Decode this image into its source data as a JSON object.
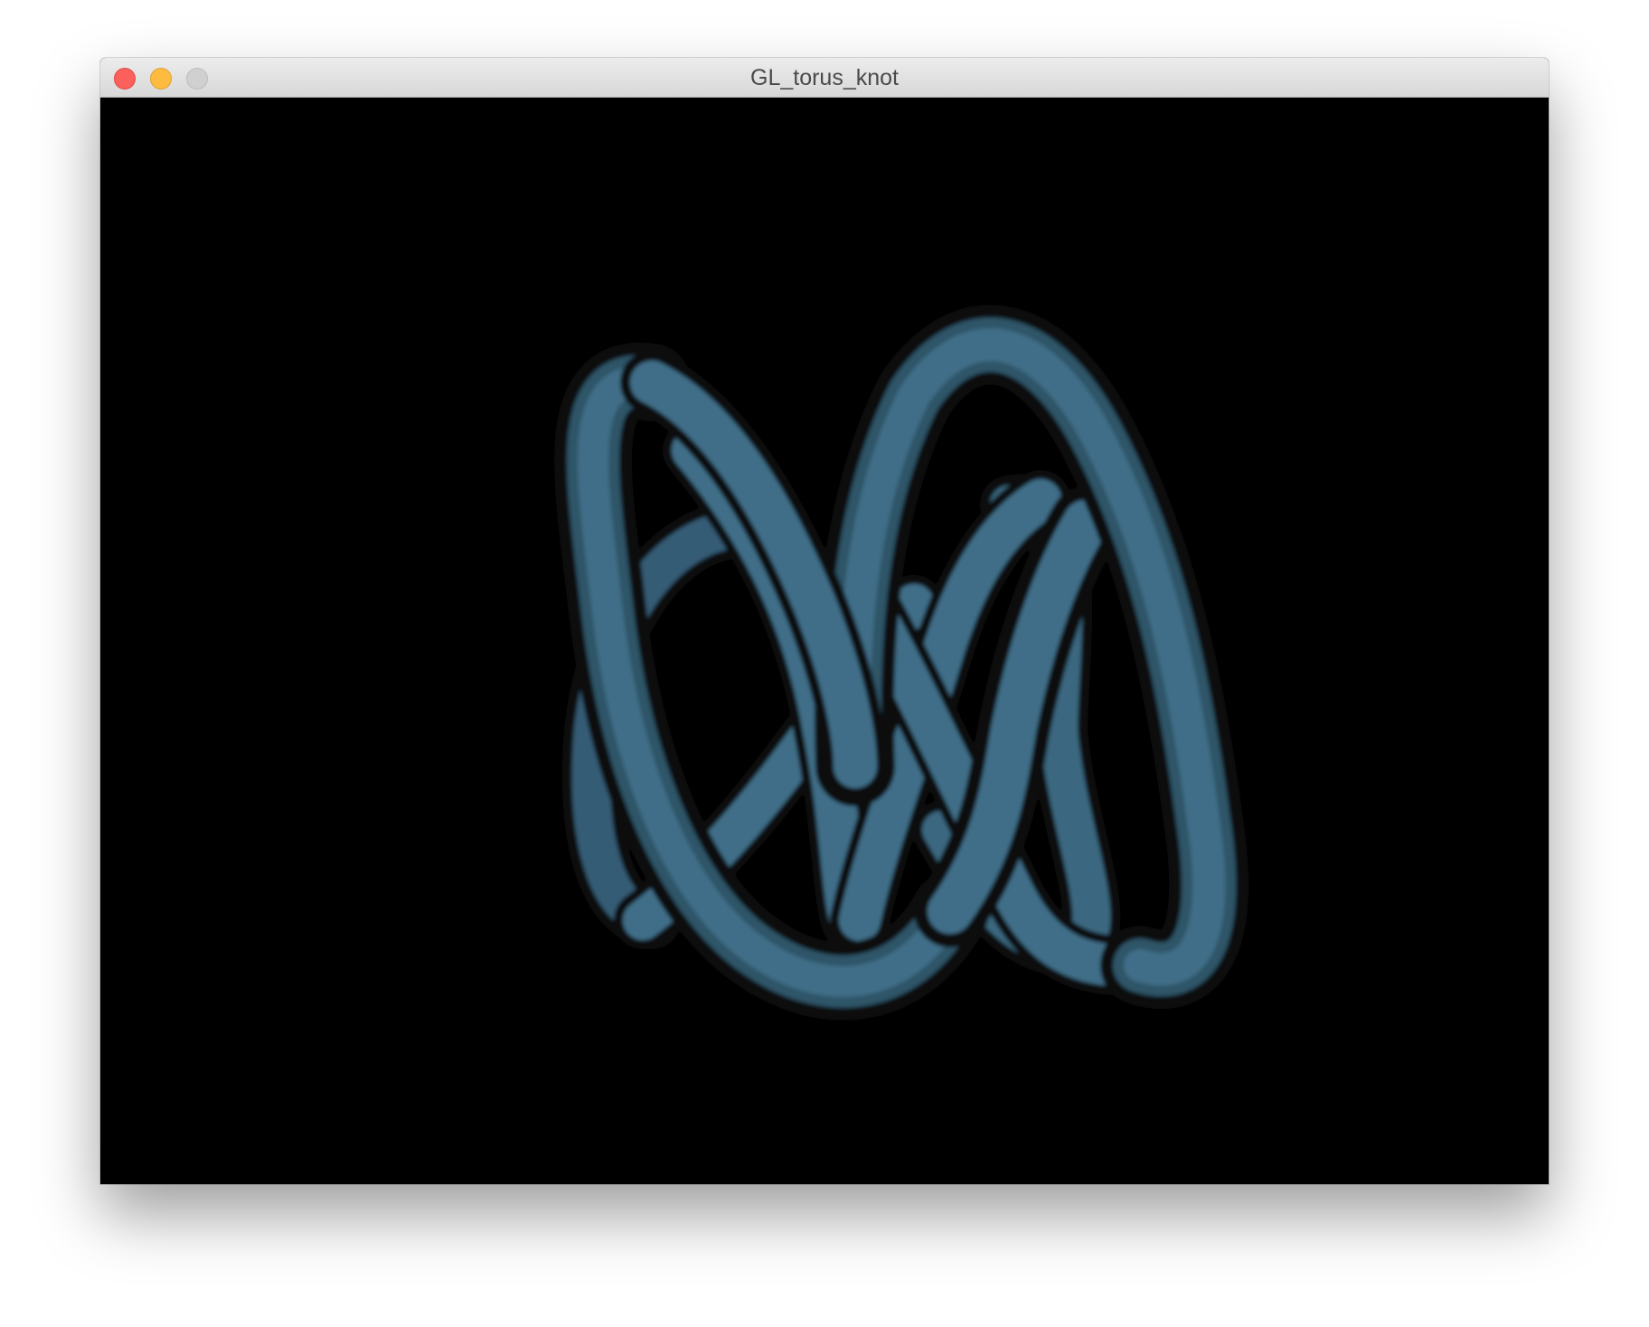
{
  "window": {
    "title": "GL_torus_knot"
  },
  "controls": {
    "close": "close-icon",
    "minimize": "minimize-icon",
    "zoom": "zoom-icon"
  },
  "scene": {
    "object": "torus-knot",
    "tube_color": "#3f6e88",
    "background": "#000000"
  }
}
